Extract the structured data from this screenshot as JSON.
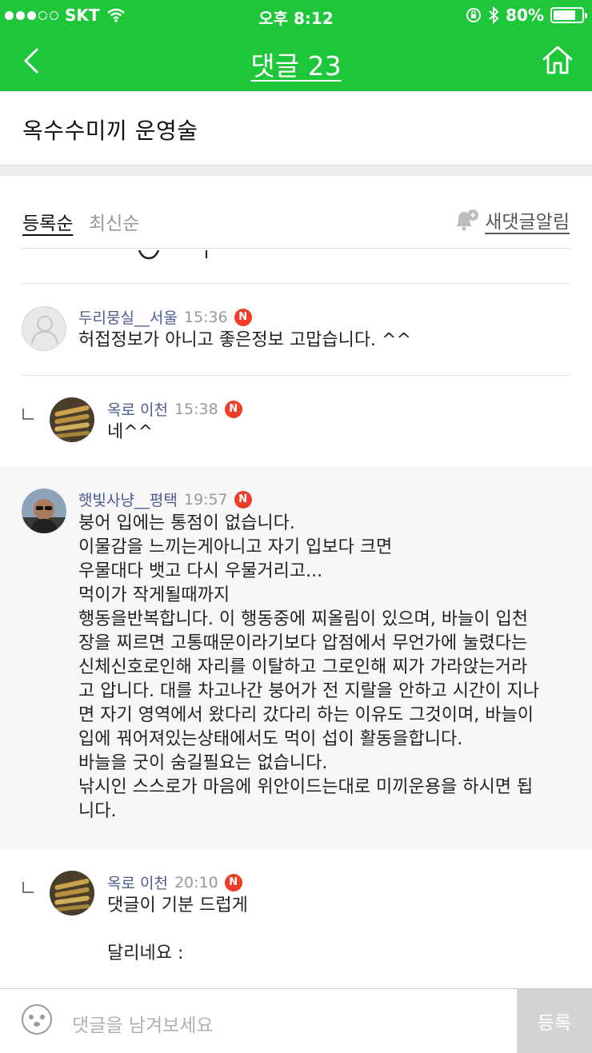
{
  "status": {
    "carrier": "SKT",
    "time": "오후 8:12",
    "battery": "80%",
    "battery_level": 0.8
  },
  "nav": {
    "title": "댓글 23",
    "back_icon": "back-chevron-icon",
    "home_icon": "home-icon"
  },
  "post": {
    "title": "옥수수미끼  운영술"
  },
  "sort": {
    "by_registration": "등록순",
    "by_latest": "최신순",
    "alert": "새댓글알림"
  },
  "comments": [
    {
      "name": "두리뭉실__서울",
      "time": "15:36",
      "badge": "N",
      "text": "허접정보가 아니고 좋은정보 고맙습니다. ^^"
    },
    {
      "name": "옥로 이천",
      "time": "15:38",
      "badge": "N",
      "text": "네^^"
    },
    {
      "name": "햇빛사냥__평택",
      "time": "19:57",
      "badge": "N",
      "text": "붕어 입에는 통점이 없습니다.\n이물감을 느끼는게아니고 자기 입보다 크면\n우물대다 뱃고 다시 우물거리고...\n먹이가 작게될때까지\n행동을반복합니다. 이 행동중에 찌올림이 있으며, 바늘이 입천\n장을 찌르면 고통때문이라기보다 압점에서 무언가에 눌렸다는\n신체신호로인해 자리를 이탈하고 그로인해 찌가 가라앉는거라\n고 압니다. 대를 차고나간 붕어가 전 지랄을 안하고 시간이 지나\n면 자기 영역에서 왔다리 갔다리 하는 이유도 그것이며, 바늘이\n입에 꿔어져있는상태에서도 먹이 섭이 활동을합니다.\n바늘을 굿이 숨길필요는 없습니다.\n낚시인 스스로가 마음에 위안이드는대로 미끼운용을 하시면 됩\n니다."
    },
    {
      "name": "옥로 이천",
      "time": "20:10",
      "badge": "N",
      "text": "댓글이 기분 드럽게\n\n달리네요 :"
    }
  ],
  "input": {
    "placeholder": "댓글을 남겨보세요",
    "submit": "등록"
  },
  "colors": {
    "brand": "#1ec73a",
    "badge": "#ef3d2a",
    "name": "#4b5b93"
  }
}
